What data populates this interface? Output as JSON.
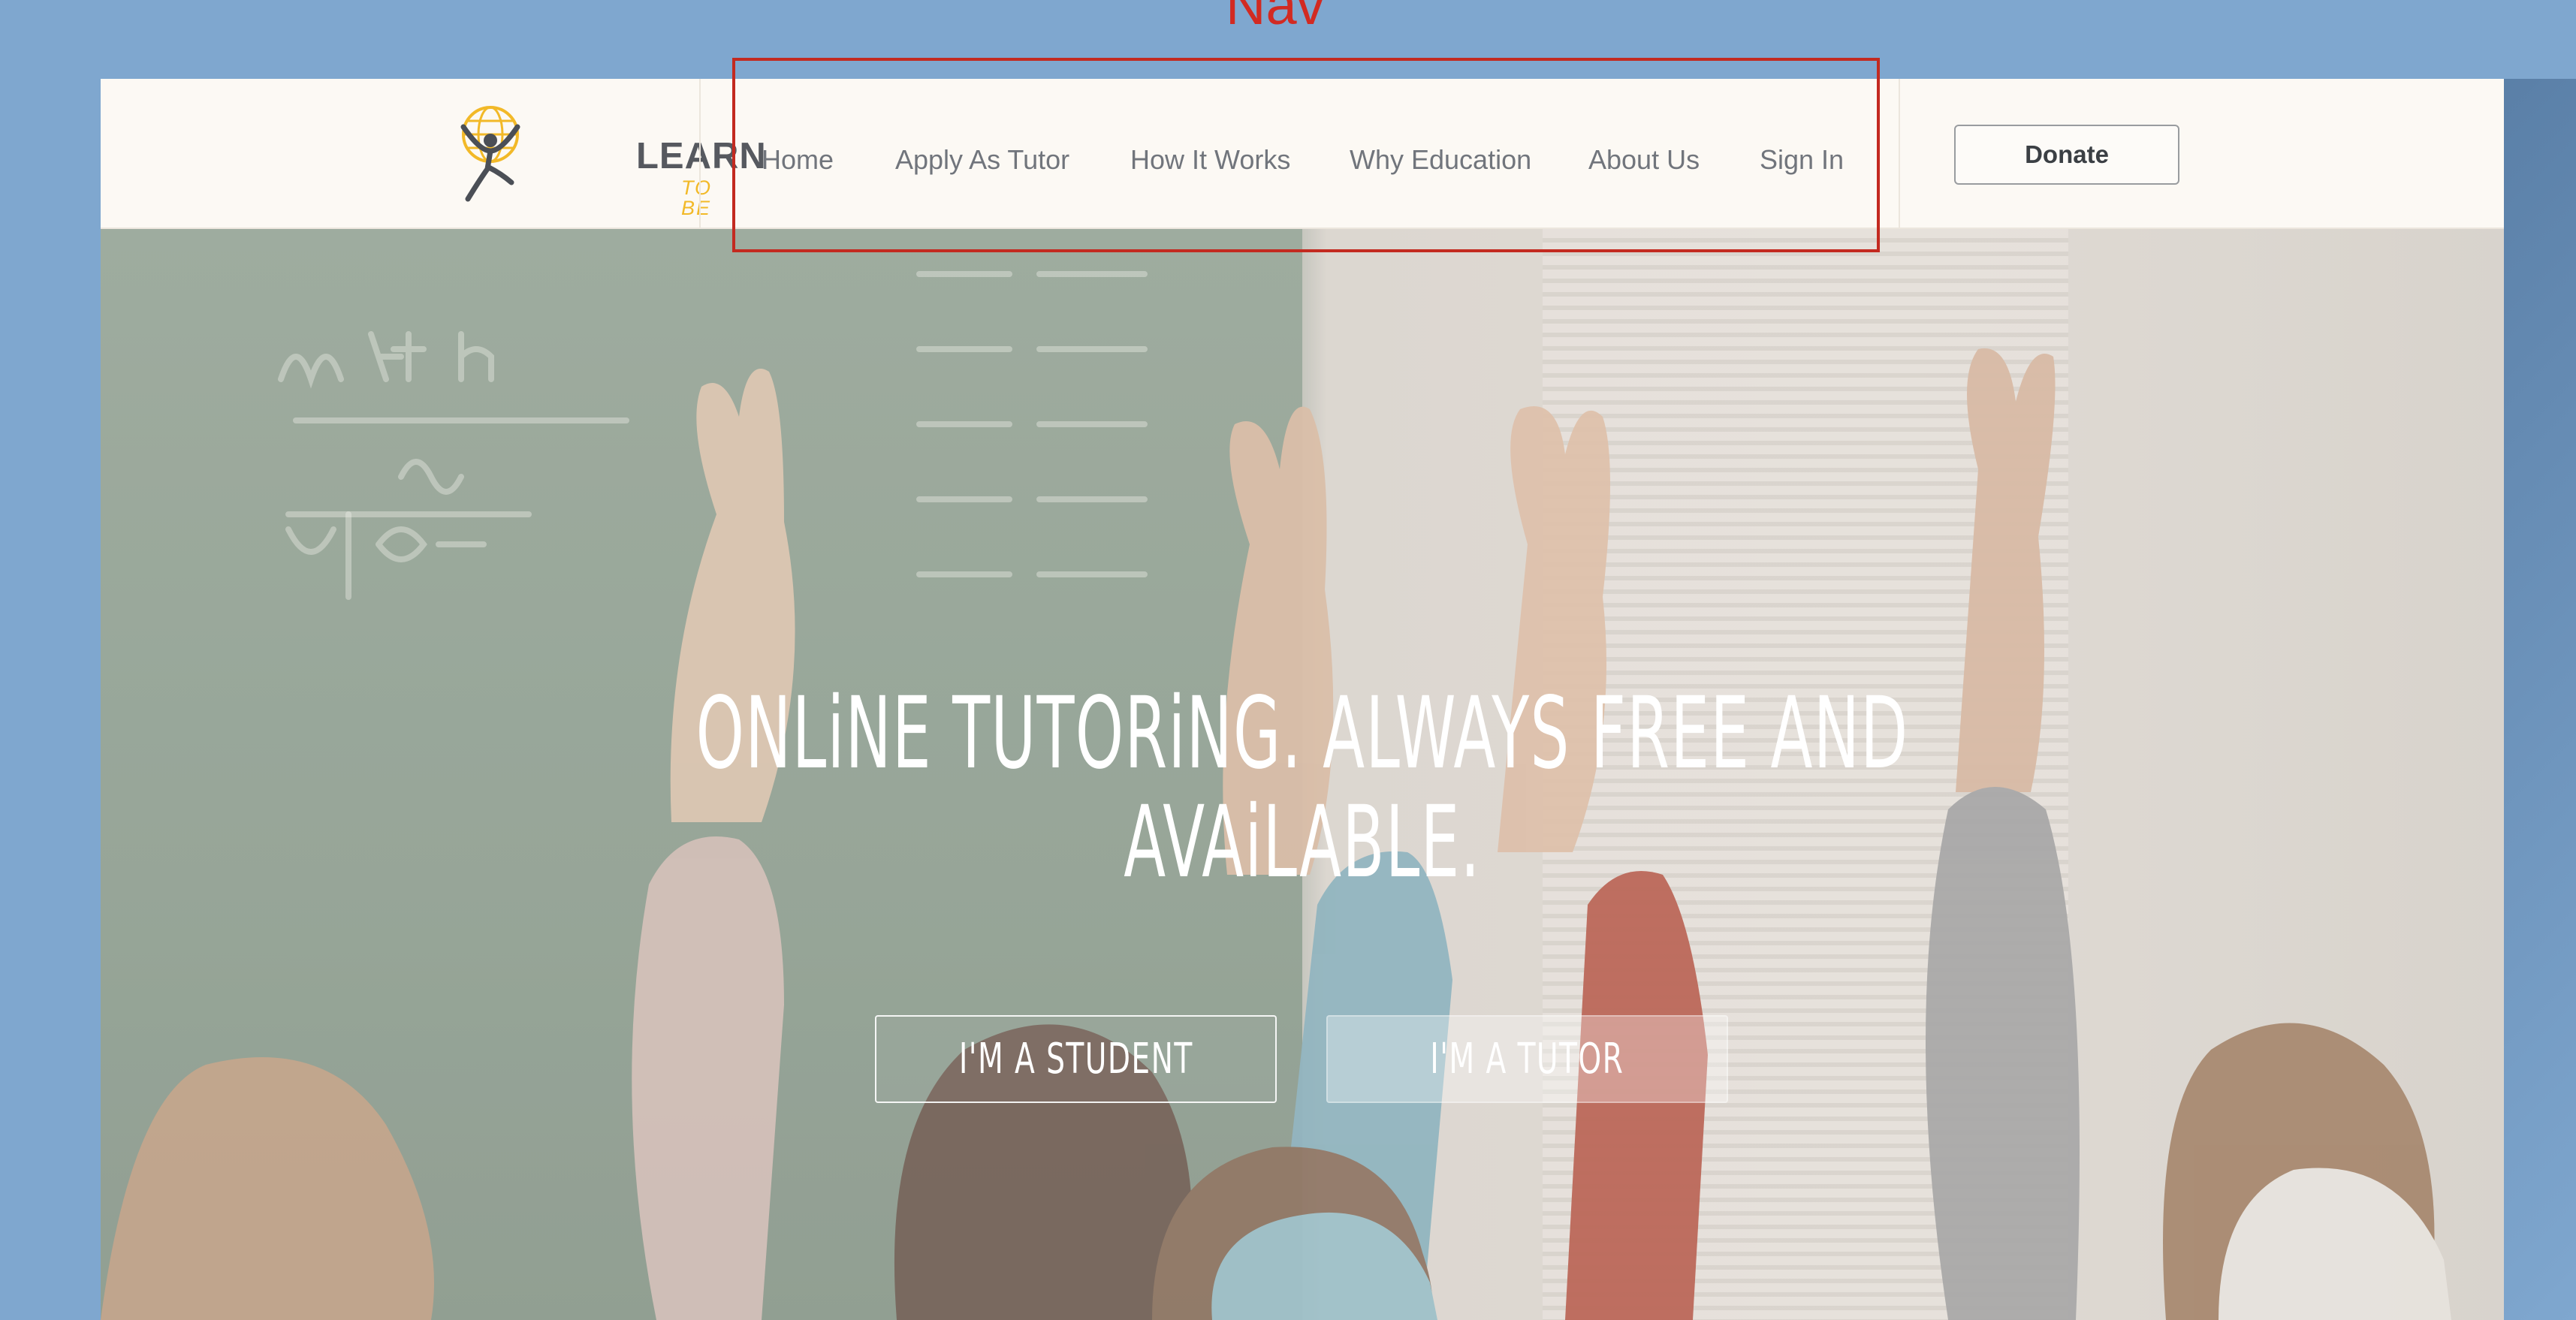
{
  "annotation": {
    "label": "Nav",
    "color": "#d22a22"
  },
  "header": {
    "logo": {
      "main_text": "LEARN",
      "sub_text": "TO BE"
    },
    "nav": {
      "items": [
        {
          "label": "Home"
        },
        {
          "label": "Apply As Tutor"
        },
        {
          "label": "How It Works"
        },
        {
          "label": "Why Education"
        },
        {
          "label": "About Us"
        },
        {
          "label": "Sign In"
        }
      ]
    },
    "donate_label": "Donate"
  },
  "hero": {
    "headline": "ONLiNE TUTORiNG. ALWAYS FREE AND AVAiLABLE.",
    "buttons": {
      "student_label": "I'M A STUDENT",
      "tutor_label": "I'M A TUTOR"
    }
  },
  "colors": {
    "page_background": "#7fa7cf",
    "header_background": "#fcf9f4",
    "nav_text": "#71757c",
    "logo_accent": "#f2b928"
  }
}
